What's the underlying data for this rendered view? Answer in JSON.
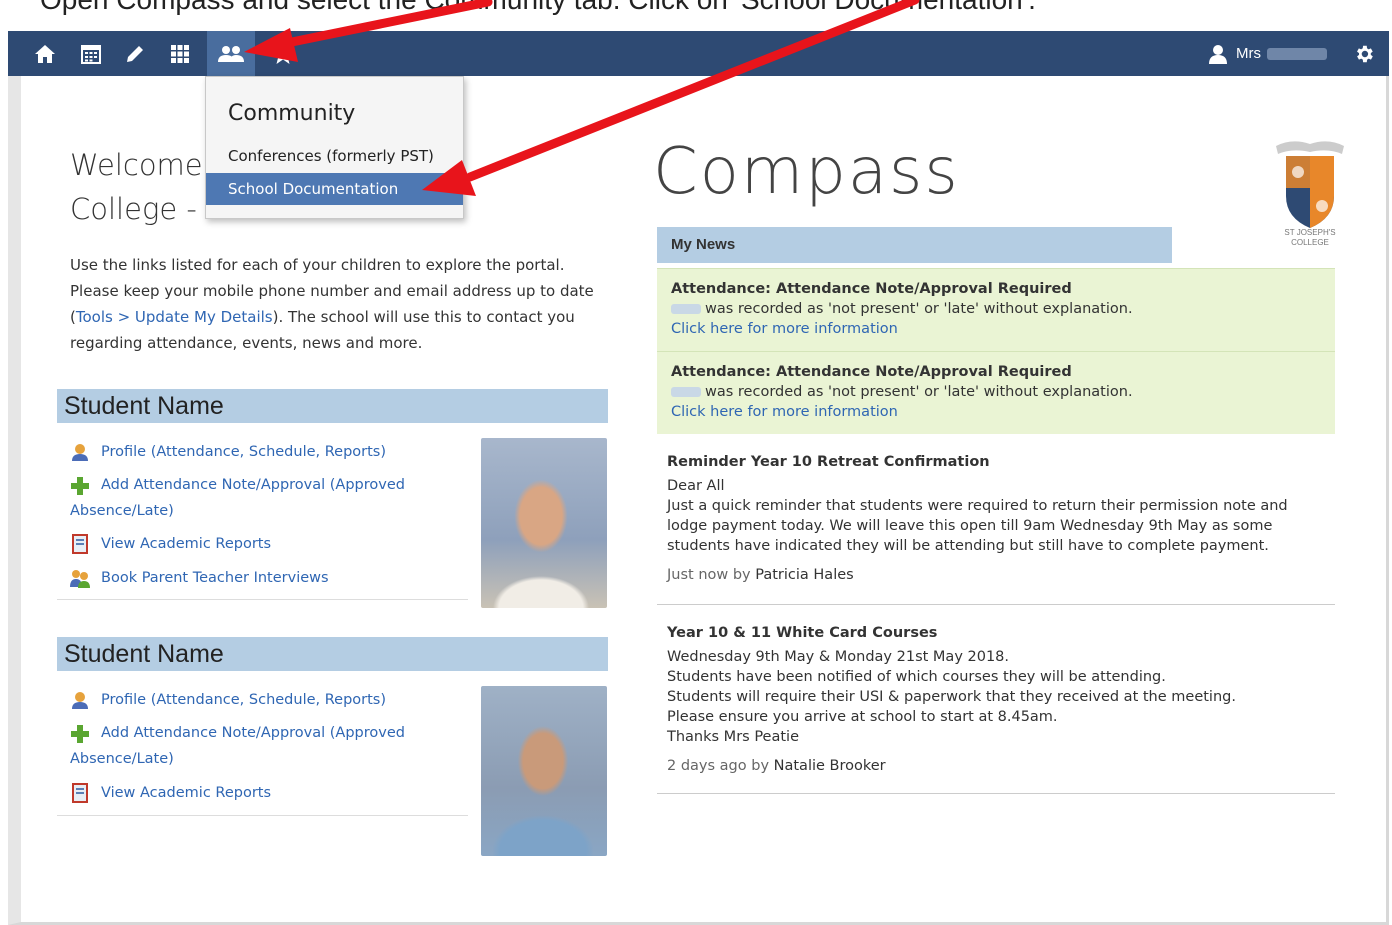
{
  "instruction": "Open Compass and select the Community tab. Click on 'School Documentation'.",
  "navbar": {
    "icons": [
      "home-icon",
      "calendar-icon",
      "pencil-icon",
      "grid-icon",
      "community-icon",
      "star-icon"
    ],
    "user_prefix": "Mrs",
    "bg_color": "#2e4a73",
    "active_color": "#496d9e"
  },
  "dropdown": {
    "title": "Community",
    "items": [
      {
        "label": "Conferences (formerly PST)",
        "selected": false
      },
      {
        "label": "School Documentation",
        "selected": true
      }
    ]
  },
  "welcome": {
    "line1": "Welcome",
    "line2": "College -",
    "intro_text1": "Use the links listed for each of your children to explore the portal. Please keep your mobile phone number and email address up to date (",
    "intro_link": "Tools > Update My Details",
    "intro_text2": "). The school will use this to contact you regarding attendance, events, news and more."
  },
  "students": [
    {
      "name": "Student Name",
      "links": {
        "profile": "Profile (Attendance, Schedule, Reports)",
        "attendance": "Add Attendance Note/Approval (Approved Absence/Late)",
        "reports": "View Academic Reports",
        "interviews": "Book Parent Teacher Interviews"
      }
    },
    {
      "name": "Student Name",
      "links": {
        "profile": "Profile (Attendance, Schedule, Reports)",
        "attendance": "Add Attendance Note/Approval (Approved Absence/Late)",
        "reports": "View Academic Reports"
      }
    }
  ],
  "brand": {
    "title": "Compass",
    "school_line1": "ST JOSEPH'S",
    "school_line2": "COLLEGE"
  },
  "news": {
    "header": "My News",
    "alerts": [
      {
        "title": "Attendance: Attendance Note/Approval Required",
        "text": "was recorded as 'not present' or 'late' without explanation.",
        "link": "Click here for more information"
      },
      {
        "title": "Attendance: Attendance Note/Approval Required",
        "text": "was recorded as 'not present' or 'late' without explanation.",
        "link": "Click here for more information"
      }
    ],
    "posts": [
      {
        "title": "Reminder Year 10 Retreat Confirmation",
        "lines": [
          "Dear All",
          "Just a quick reminder that students were required to return their permission note and lodge payment today. We will leave this open till 9am Wednesday 9th May as some students have indicated they will be attending but still have to complete payment."
        ],
        "time": "Just now by",
        "author": "Patricia Hales"
      },
      {
        "title": "Year 10 & 11 White Card Courses",
        "lines": [
          "Wednesday 9th May & Monday 21st May 2018.",
          "Students have been notified of which courses they will be attending.",
          "Students will require their USI & paperwork that they received at the meeting.",
          "Please ensure you arrive at school to start at 8.45am.",
          "Thanks Mrs Peatie"
        ],
        "time": "2 days ago by",
        "author": "Natalie Brooker"
      }
    ]
  },
  "colors": {
    "link": "#2f66b3",
    "section_head": "#b4cde3",
    "alert_bg": "#eaf4d4",
    "arrow": "#e8141b"
  }
}
